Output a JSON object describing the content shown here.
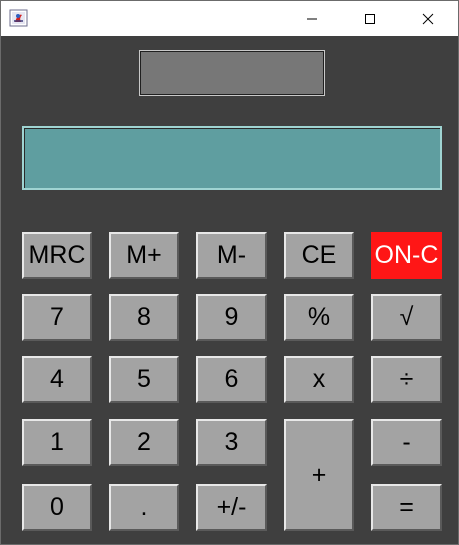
{
  "window": {
    "minimize_glyph": "—",
    "maximize_glyph": "☐",
    "close_glyph": "✕"
  },
  "display": {
    "memory_value": "",
    "main_value": ""
  },
  "keys": {
    "mrc": "MRC",
    "m_plus": "M+",
    "m_minus": "M-",
    "ce": "CE",
    "on_c": "ON-C",
    "seven": "7",
    "eight": "8",
    "nine": "9",
    "percent": "%",
    "sqrt": "√",
    "four": "4",
    "five": "5",
    "six": "6",
    "multiply": "x",
    "divide": "÷",
    "one": "1",
    "two": "2",
    "three": "3",
    "plus": "+",
    "minus": "-",
    "zero": "0",
    "dot": ".",
    "plus_minus": "+/-",
    "equals": "="
  },
  "colors": {
    "body_bg": "#3f3f3f",
    "key_bg": "#a3a3a3",
    "on_c_bg": "#ff1616",
    "display_bg": "#5f9ea0",
    "memory_bg": "#777777"
  }
}
